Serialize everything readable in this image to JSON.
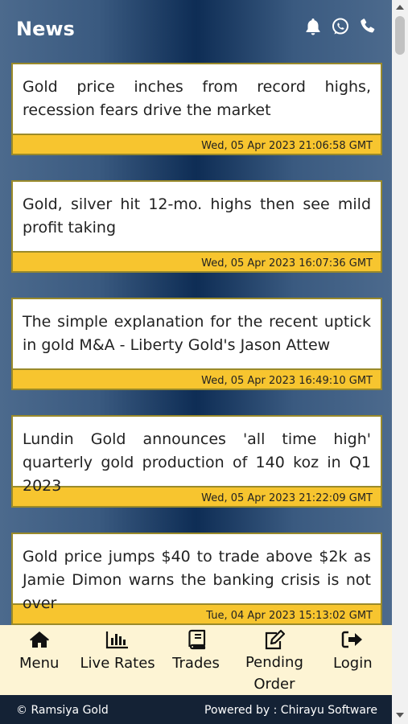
{
  "header": {
    "title": "News",
    "icons": [
      "bell-icon",
      "whatsapp-icon",
      "phone-icon"
    ]
  },
  "news": [
    {
      "headline": "Gold price inches from record highs, recession fears drive the market",
      "date": "Wed, 05 Apr 2023 21:06:58 GMT"
    },
    {
      "headline": "Gold, silver hit 12-mo. highs then see mild profit taking",
      "date": "Wed, 05 Apr 2023 16:07:36 GMT"
    },
    {
      "headline": "The simple explanation for the recent uptick in gold M&A - Liberty Gold's Jason Attew",
      "date": "Wed, 05 Apr 2023 16:49:10 GMT"
    },
    {
      "headline": "Lundin Gold announces 'all time high' quarterly gold production of 140 koz in Q1 2023",
      "date": "Wed, 05 Apr 2023 21:22:09 GMT"
    },
    {
      "headline": "Gold price jumps $40 to trade above $2k as Jamie Dimon warns the banking crisis is not over",
      "date": "Tue, 04 Apr 2023 15:13:02 GMT"
    }
  ],
  "nav": [
    {
      "label": "Menu",
      "icon": "home-icon"
    },
    {
      "label": "Live Rates",
      "icon": "bar-chart-icon"
    },
    {
      "label": "Trades",
      "icon": "book-icon"
    },
    {
      "label": "Pending Order",
      "icon": "edit-icon"
    },
    {
      "label": "Login",
      "icon": "sign-out-icon"
    }
  ],
  "footer": {
    "left": "© Ramsiya Gold",
    "right": "Powered by : Chirayu Software"
  },
  "colors": {
    "card_footer": "#f7c52f",
    "nav_bg": "#fdf4d4",
    "footer_bg": "#142235"
  }
}
